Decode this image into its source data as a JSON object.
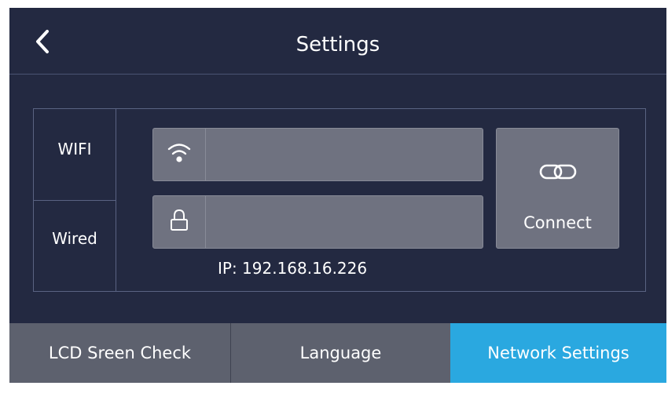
{
  "header": {
    "back_icon": "chevron-left-icon",
    "title": "Settings"
  },
  "network": {
    "modes": [
      "WIFI",
      "Wired"
    ],
    "ssid_field": {
      "icon": "wifi-icon",
      "value": "",
      "placeholder": ""
    },
    "password_field": {
      "icon": "lock-icon",
      "value": "",
      "placeholder": ""
    },
    "connect": {
      "icon": "link-icon",
      "label": "Connect"
    },
    "ip_text": "IP: 192.168.16.226"
  },
  "tabs": [
    {
      "label": "LCD Sreen Check",
      "active": false
    },
    {
      "label": "Language",
      "active": false
    },
    {
      "label": "Network Settings",
      "active": true
    }
  ],
  "colors": {
    "background": "#232941",
    "field": "#6f7280",
    "tab_inactive": "#5d616e",
    "tab_active": "#2aa8e0",
    "text": "#ffffff"
  }
}
